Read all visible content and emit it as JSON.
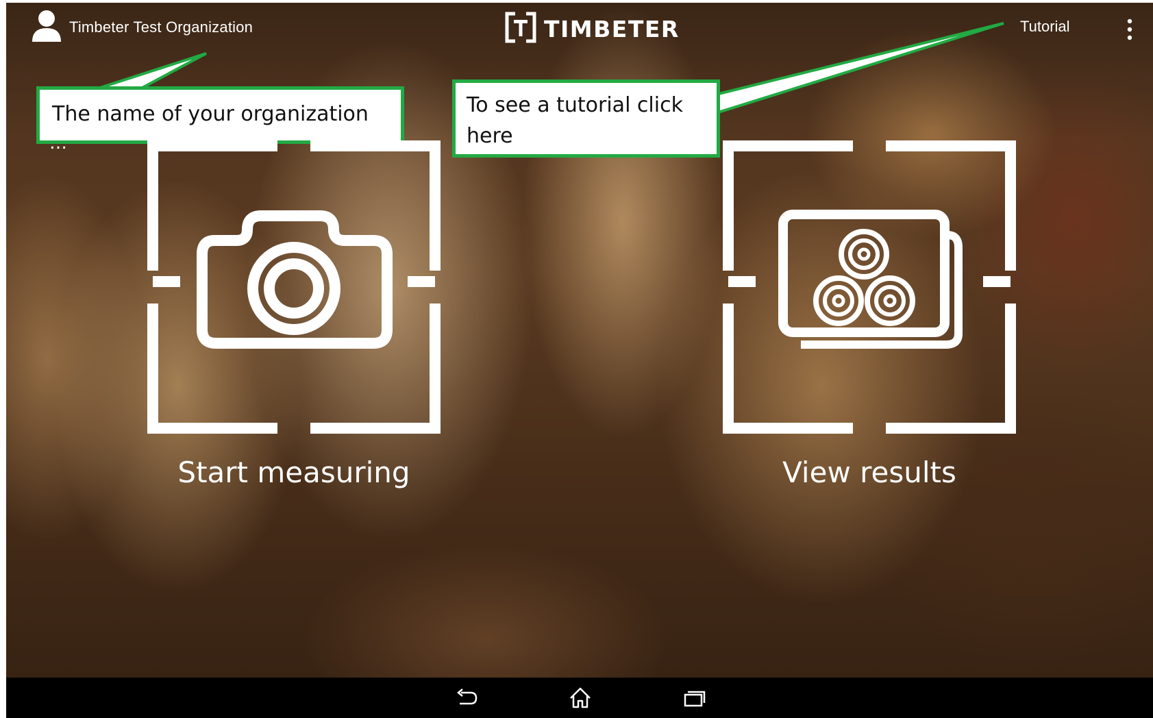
{
  "topbar": {
    "org_name": "Timbeter Test Organization",
    "logo_text": "TIMBETER",
    "tutorial_label": "Tutorial"
  },
  "callouts": {
    "org": "The name of  your organization",
    "org_ellipsis": "…",
    "tutorial_line1": "To see a tutorial click",
    "tutorial_line2": "here"
  },
  "actions": {
    "start_label": "Start measuring",
    "results_label": "View results"
  },
  "icons": {
    "user": "user-icon",
    "logo": "timbeter-logo-icon",
    "overflow": "more-vertical-icon",
    "camera": "camera-icon",
    "results": "log-stack-gallery-icon",
    "back": "back-icon",
    "home": "home-icon",
    "recents": "recent-apps-icon"
  },
  "colors": {
    "callout_border": "#22aa44",
    "callout_background": "#ffffff",
    "navbar": "#000000",
    "foreground": "#ffffff"
  }
}
